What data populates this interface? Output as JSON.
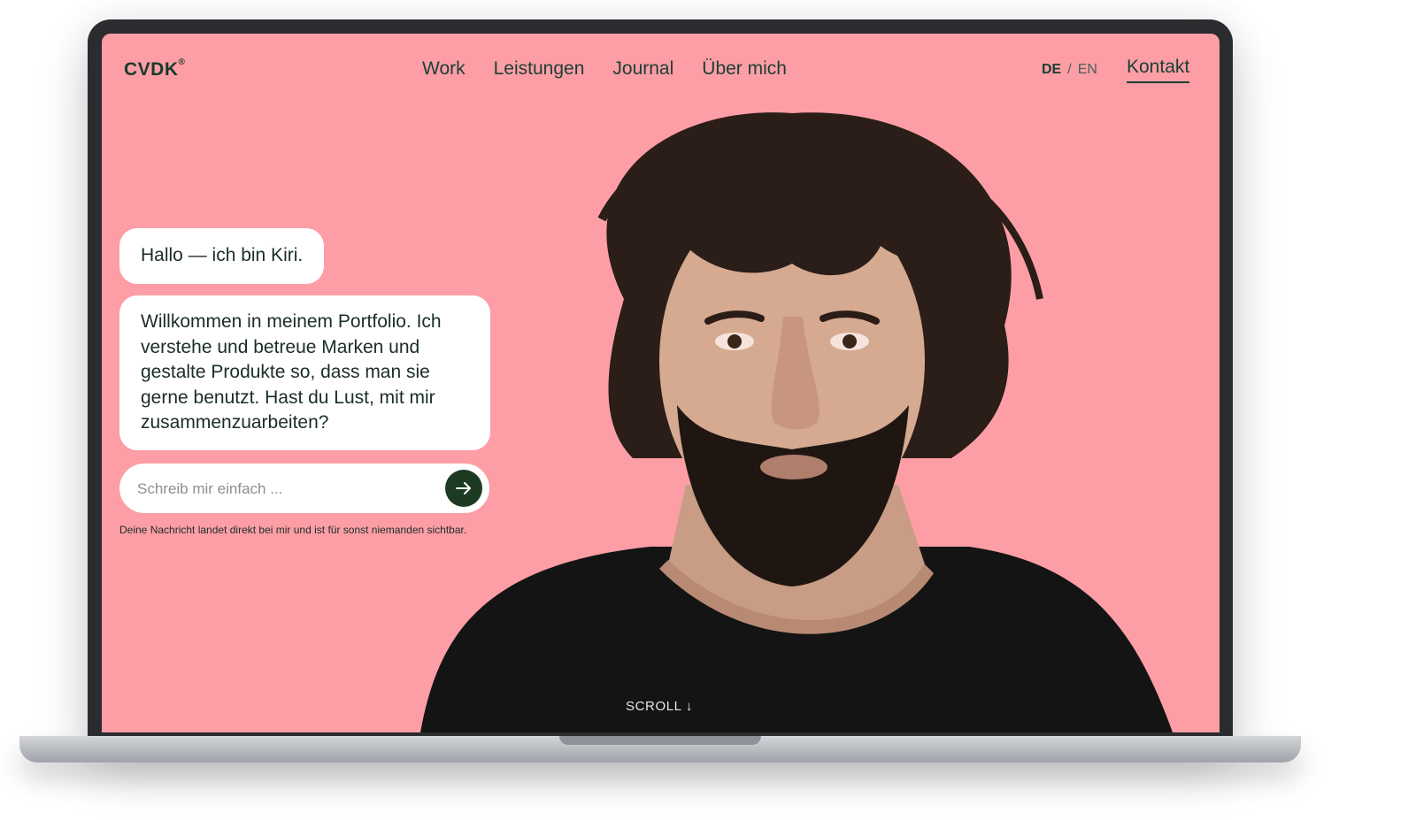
{
  "header": {
    "logo": "CVDK",
    "logo_mark": "®",
    "nav": [
      "Work",
      "Leistungen",
      "Journal",
      "Über mich"
    ],
    "lang_active": "DE",
    "lang_sep": "/",
    "lang_other": "EN",
    "contact": "Kontakt"
  },
  "chat": {
    "greeting": "Hallo — ich bin Kiri.",
    "intro": "Willkommen in meinem Portfolio. Ich verstehe und betreue Marken und gestalte Produkte so, dass man sie gerne benutzt. Hast du Lust, mit mir zusammenzuarbeiten?",
    "input_placeholder": "Schreib mir einfach ...",
    "send_icon": "arrow-right-icon",
    "privacy_note": "Deine Nachricht landet direkt bei mir und ist für sonst niemanden sichtbar."
  },
  "scroll_label": "SCROLL ↓",
  "colors": {
    "background": "#fd9ea6",
    "accent_dark_green": "#1d3b22",
    "text_green": "#1a3f33",
    "bubble": "#ffffff"
  }
}
